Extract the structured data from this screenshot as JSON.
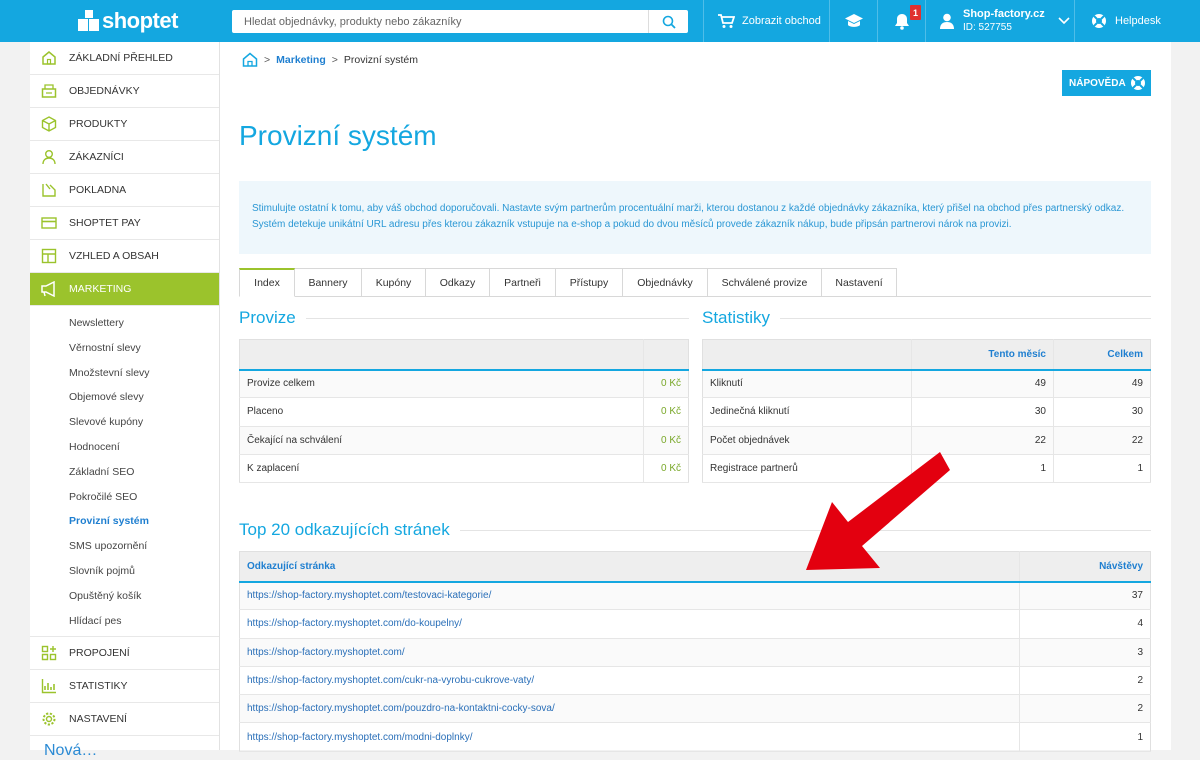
{
  "header": {
    "logo_text": "shoptet",
    "search_placeholder": "Hledat objednávky, produkty nebo zákazníky",
    "store_button": "Zobrazit obchod",
    "notifications_count": "1",
    "user_name": "Shop-factory.cz",
    "user_id": "ID: 527755",
    "helpdesk": "Helpdesk"
  },
  "sidebar": {
    "items": [
      {
        "label": "ZÁKLADNÍ PŘEHLED",
        "icon": "home-icon"
      },
      {
        "label": "OBJEDNÁVKY",
        "icon": "orders-icon"
      },
      {
        "label": "PRODUKTY",
        "icon": "box-icon"
      },
      {
        "label": "ZÁKAZNÍCI",
        "icon": "person-icon"
      },
      {
        "label": "POKLADNA",
        "icon": "register-icon"
      },
      {
        "label": "SHOPTET PAY",
        "icon": "card-icon"
      },
      {
        "label": "VZHLED A OBSAH",
        "icon": "layout-icon"
      },
      {
        "label": "MARKETING",
        "icon": "megaphone-icon"
      }
    ],
    "sub_items": [
      "Newslettery",
      "Věrnostní slevy",
      "Množstevní slevy",
      "Objemové slevy",
      "Slevové kupóny",
      "Hodnocení",
      "Základní SEO",
      "Pokročilé SEO",
      "Provizní systém",
      "SMS upozornění",
      "Slovník pojmů",
      "Opuštěný košík",
      "Hlídací pes"
    ],
    "bottom_items": [
      {
        "label": "PROPOJENÍ",
        "icon": "connect-icon"
      },
      {
        "label": "STATISTIKY",
        "icon": "chart-icon"
      },
      {
        "label": "NASTAVENÍ",
        "icon": "gear-icon"
      }
    ],
    "footer": "Nová…"
  },
  "breadcrumb": {
    "link": "Marketing",
    "current": "Provizní systém",
    "sep": ">"
  },
  "help_button": "NÁPOVĚDA",
  "page_title": "Provizní systém",
  "info_text": "Stimulujte ostatní k tomu, aby váš obchod doporučovali. Nastavte svým partnerům procentuální marži, kterou dostanou z každé objednávky zákazníka, který přišel na obchod přes partnerský odkaz. Systém detekuje unikátní URL adresu přes kterou zákazník vstupuje na e-shop a pokud do dvou měsíců provede zákazník nákup, bude připsán partnerovi nárok na provizi.",
  "tabs": [
    "Index",
    "Bannery",
    "Kupóny",
    "Odkazy",
    "Partneři",
    "Přístupy",
    "Objednávky",
    "Schválené provize",
    "Nastavení"
  ],
  "provize": {
    "title": "Provize",
    "rows": [
      {
        "label": "Provize celkem",
        "value": "0 Kč"
      },
      {
        "label": "Placeno",
        "value": "0 Kč"
      },
      {
        "label": "Čekající na schválení",
        "value": "0 Kč"
      },
      {
        "label": "K zaplacení",
        "value": "0 Kč"
      }
    ]
  },
  "statistiky": {
    "title": "Statistiky",
    "col_month": "Tento měsíc",
    "col_total": "Celkem",
    "rows": [
      {
        "label": "Kliknutí",
        "month": "49",
        "total": "49"
      },
      {
        "label": "Jedinečná kliknutí",
        "month": "30",
        "total": "30"
      },
      {
        "label": "Počet objednávek",
        "month": "22",
        "total": "22"
      },
      {
        "label": "Registrace partnerů",
        "month": "1",
        "total": "1"
      }
    ]
  },
  "top20": {
    "title": "Top 20 odkazujících stránek",
    "col_page": "Odkazující stránka",
    "col_visits": "Návštěvy",
    "rows": [
      {
        "url": "https://shop-factory.myshoptet.com/testovaci-kategorie/",
        "visits": "37"
      },
      {
        "url": "https://shop-factory.myshoptet.com/do-koupelny/",
        "visits": "4"
      },
      {
        "url": "https://shop-factory.myshoptet.com/",
        "visits": "3"
      },
      {
        "url": "https://shop-factory.myshoptet.com/cukr-na-vyrobu-cukrove-vaty/",
        "visits": "2"
      },
      {
        "url": "https://shop-factory.myshoptet.com/pouzdro-na-kontaktni-cocky-sova/",
        "visits": "2"
      },
      {
        "url": "https://shop-factory.myshoptet.com/modni-doplnky/",
        "visits": "1"
      }
    ]
  },
  "colors": {
    "brand_blue": "#14a7e0",
    "active_green": "#9bc32c",
    "arrow_red": "#e3000f"
  }
}
